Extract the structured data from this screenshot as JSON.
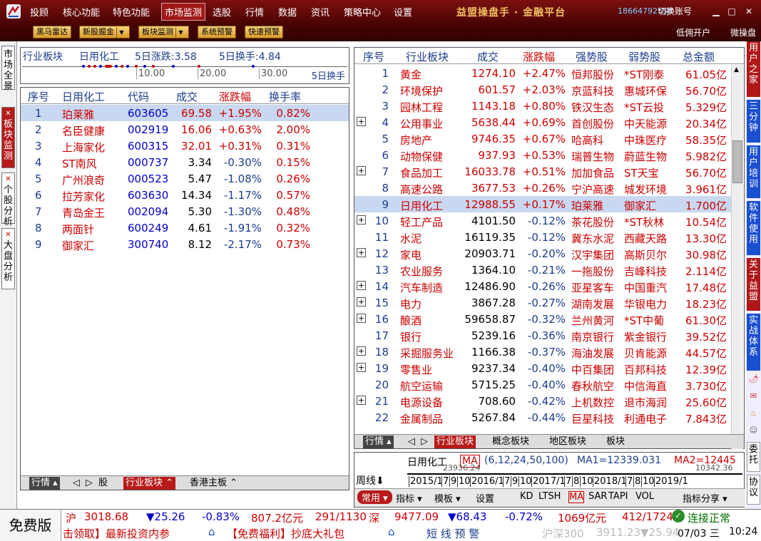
{
  "topbar": {
    "menu": [
      "投顾",
      "核心功能",
      "特色功能",
      "市场监测",
      "选股",
      "行情",
      "数据",
      "资讯",
      "策略中心",
      "设置"
    ],
    "active_menu": "市场监测",
    "brand": "益盟操盘手 · 金融平台",
    "phone": "18664792558",
    "switch_account": "切换账号",
    "colors": {
      "bar": "#6a0808",
      "brand_text": "#f0c060",
      "phone_text": "#7fd0ff"
    }
  },
  "toolbar": {
    "buttons": [
      "黑马雷达",
      "新股掘金",
      "板块监测",
      "系统预警",
      "快速预警"
    ],
    "right_links": [
      "低佣开户",
      "微操盘"
    ]
  },
  "left_tabs": [
    {
      "label": "市场全景",
      "active": false,
      "closable": false
    },
    {
      "label": "板块监测",
      "active": true,
      "closable": true
    },
    {
      "label": "个股分析",
      "active": false,
      "closable": true
    },
    {
      "label": "大盘分析",
      "active": false,
      "closable": true
    }
  ],
  "right_tabs": [
    {
      "label": "用户之家",
      "color": "#b01818"
    },
    {
      "label": "三分钟",
      "color": "#1a4fd0"
    },
    {
      "label": "用户培训",
      "color": "#1a4fd0"
    },
    {
      "label": "软件使用",
      "color": "#1a4fd0"
    },
    {
      "label": "关于益盟",
      "color": "#b01818"
    },
    {
      "label": "实战体系",
      "color": "#1a4fd0"
    }
  ],
  "right_bottom": [
    "委托",
    "协议"
  ],
  "sector_summary": {
    "label": "行业板块",
    "name": "日用化工",
    "change_5d": "5日涨跌:3.58",
    "turnover_5d": "5日换手:4.84",
    "ticks": [
      "10.00",
      "20.00",
      "30.00"
    ],
    "axis_label": "5日换手"
  },
  "stocks": {
    "headers": [
      "序号",
      "日用化工",
      "代码",
      "成交",
      "涨跌幅",
      "换手率"
    ],
    "rows": [
      [
        "1",
        "珀莱雅",
        "603605",
        "69.58",
        "+1.95%",
        "0.82%"
      ],
      [
        "2",
        "名臣健康",
        "002919",
        "16.06",
        "+0.63%",
        "2.00%"
      ],
      [
        "3",
        "上海家化",
        "600315",
        "32.01",
        "+0.31%",
        "0.31%"
      ],
      [
        "4",
        "ST南风",
        "000737",
        "3.34",
        "-0.30%",
        "0.15%"
      ],
      [
        "5",
        "广州浪奇",
        "000523",
        "5.47",
        "-1.08%",
        "0.26%"
      ],
      [
        "6",
        "拉芳家化",
        "603630",
        "14.34",
        "-1.17%",
        "0.57%"
      ],
      [
        "7",
        "青岛金王",
        "002094",
        "5.30",
        "-1.30%",
        "0.48%"
      ],
      [
        "8",
        "两面针",
        "600249",
        "4.61",
        "-1.91%",
        "0.32%"
      ],
      [
        "9",
        "御家汇",
        "300740",
        "8.12",
        "-2.17%",
        "0.73%"
      ]
    ],
    "selected_index": 0,
    "bottom_tabs": [
      "行情",
      "股",
      "行业板块",
      "香港主板"
    ]
  },
  "sectors": {
    "headers": [
      "序号",
      "行业板块",
      "成交",
      "涨跌幅",
      "强势股",
      "弱势股",
      "总金额"
    ],
    "rows": [
      [
        "1",
        "黄金",
        "1274.10",
        "+2.47%",
        "恒邦股份",
        "*ST刚泰",
        "61.05亿"
      ],
      [
        "2",
        "环境保护",
        "601.57",
        "+2.03%",
        "京蓝科技",
        "惠城环保",
        "56.70亿"
      ],
      [
        "3",
        "园林工程",
        "1143.18",
        "+0.80%",
        "铁汉生态",
        "*ST云投",
        "5.329亿"
      ],
      [
        "4",
        "公用事业",
        "5638.44",
        "+0.69%",
        "首创股份",
        "中天能源",
        "20.34亿"
      ],
      [
        "5",
        "房地产",
        "9746.35",
        "+0.67%",
        "哈高科",
        "中珠医疗",
        "58.35亿"
      ],
      [
        "6",
        "动物保健",
        "937.93",
        "+0.53%",
        "瑞普生物",
        "蔚蓝生物",
        "5.982亿"
      ],
      [
        "7",
        "食品加工",
        "16033.78",
        "+0.51%",
        "加加食品",
        "ST天宝",
        "56.70亿"
      ],
      [
        "8",
        "高速公路",
        "3677.53",
        "+0.26%",
        "宁沪高速",
        "城发环境",
        "3.961亿"
      ],
      [
        "9",
        "日用化工",
        "12988.55",
        "+0.17%",
        "珀莱雅",
        "御家汇",
        "1.700亿"
      ],
      [
        "10",
        "轻工产品",
        "4101.50",
        "-0.12%",
        "茶花股份",
        "*ST秋林",
        "10.54亿"
      ],
      [
        "11",
        "水泥",
        "16119.35",
        "-0.12%",
        "冀东水泥",
        "西藏天路",
        "13.30亿"
      ],
      [
        "12",
        "家电",
        "20903.71",
        "-0.20%",
        "汉宇集团",
        "高斯贝尔",
        "30.98亿"
      ],
      [
        "13",
        "农业服务",
        "1364.10",
        "-0.21%",
        "一拖股份",
        "吉峰科技",
        "2.114亿"
      ],
      [
        "14",
        "汽车制造",
        "12486.90",
        "-0.26%",
        "亚星客车",
        "中国重汽",
        "17.48亿"
      ],
      [
        "15",
        "电力",
        "3867.28",
        "-0.27%",
        "湖南发展",
        "华银电力",
        "18.23亿"
      ],
      [
        "16",
        "酿酒",
        "59658.87",
        "-0.32%",
        "兰州黄河",
        "*ST中葡",
        "61.30亿"
      ],
      [
        "17",
        "银行",
        "5239.16",
        "-0.36%",
        "南京银行",
        "紫金银行",
        "39.52亿"
      ],
      [
        "18",
        "采掘服务业",
        "1166.38",
        "-0.37%",
        "海油发展",
        "贝肯能源",
        "44.57亿"
      ],
      [
        "19",
        "零售业",
        "9237.34",
        "-0.40%",
        "中百集团",
        "百邦科技",
        "12.39亿"
      ],
      [
        "20",
        "航空运输",
        "5715.25",
        "-0.40%",
        "春秋航空",
        "中信海直",
        "3.730亿"
      ],
      [
        "21",
        "电源设备",
        "708.60",
        "-0.42%",
        "上机数控",
        "退市海润",
        "25.60亿"
      ],
      [
        "22",
        "金属制品",
        "5267.84",
        "-0.44%",
        "巨星科技",
        "利通电子",
        "7.843亿"
      ]
    ],
    "expandable": [
      "4",
      "7",
      "10",
      "12",
      "14",
      "15",
      "16",
      "18",
      "19",
      "21"
    ],
    "selected_index": 8,
    "bottom_tabs": [
      "行情",
      "行业板块",
      "概念板块",
      "地区板块",
      "板块"
    ]
  },
  "kchart": {
    "name": "日用化工",
    "ma_label": "MA",
    "params": "(6,12,24,50,100)",
    "ma1": "MA1=12339.031",
    "ma2": "MA2=12445",
    "period": "周线",
    "dates": [
      "2015/1",
      "7",
      "9",
      "10",
      "2016/1",
      "7",
      "9",
      "10",
      "2017/1",
      "7",
      "8",
      "10",
      "2018/1",
      "7",
      "8",
      "10",
      "2019/1"
    ],
    "value_left": "23936.24",
    "value_right": "10342.36",
    "buttons": [
      "常用",
      "指标",
      "模板",
      "设置",
      "KD",
      "LTSH",
      "MA",
      "SAR",
      "TAPI",
      "VOL",
      "指标分享"
    ]
  },
  "status": {
    "free_version": "免费版",
    "sh_label": "沪",
    "sh_index": "3018.68",
    "sh_change": "▼25.26",
    "sh_pct": "-0.83%",
    "sh_amount": "807.2亿元",
    "sh_updown": "291/1130",
    "sz_label": "深",
    "sz_index": "9477.09",
    "sz_change": "▼68.43",
    "sz_pct": "-0.72%",
    "sz_amount": "1069亿元",
    "sz_updown": "412/1724",
    "connection": "连接正常",
    "ticker1": "击领取】最新投资内参",
    "ticker2": "【免费福利】抄底大礼包",
    "ticker3": "短 线 预 警",
    "hs300": "沪深300",
    "hs300_val": "3911.23",
    "hs300_chg": "▼25.94",
    "date": "07/03 三",
    "time": "10:24"
  }
}
